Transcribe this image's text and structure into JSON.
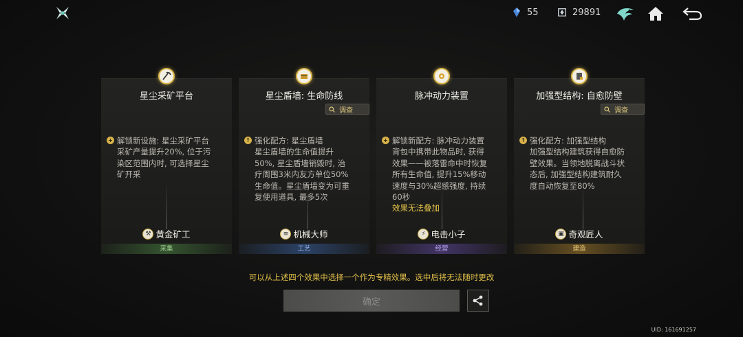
{
  "topbar": {
    "currency_a": "55",
    "currency_b": "29891"
  },
  "cards": [
    {
      "title": "星尘采矿平台",
      "has_investigate": false,
      "desc_lines": [
        "解锁新设施: 星尘采矿平台",
        "采矿产量提升20%, 位于污",
        "染区范围内时, 可选择星尘",
        "矿开采"
      ],
      "extra": "",
      "talent": "黄金矿工",
      "tag": "采集",
      "tag_color": "#9fce8f"
    },
    {
      "title": "星尘盾墙: 生命防线",
      "has_investigate": true,
      "investigate_label": "调查",
      "desc_lines": [
        "强化配方: 星尘盾墙",
        "星尘盾墙的生命值提升",
        "50%, 星尘盾墙销毁时, 治",
        "疗周围3米内友方单位50%",
        "生命值。星尘盾墙变为可重",
        "复使用道具, 最多5次"
      ],
      "extra": "",
      "talent": "机械大师",
      "tag": "工艺",
      "tag_color": "#93b3e4"
    },
    {
      "title": "脉冲动力装置",
      "has_investigate": false,
      "desc_lines": [
        "解锁新配方: 脉冲动力装置",
        "背包中携带此物品时, 获得",
        "效果——被落雷命中时恢复",
        "所有生命值, 提升15%移动",
        "速度与30%超感强度, 持续",
        "60秒"
      ],
      "extra": "效果无法叠加",
      "talent": "电击小子",
      "tag": "经营",
      "tag_color": "#b3a1e4"
    },
    {
      "title": "加强型结构: 自愈防壁",
      "has_investigate": true,
      "investigate_label": "调查",
      "desc_lines": [
        "强化配方: 加强型结构",
        "加强型结构建筑获得自愈防",
        "壁效果。当领地脱离战斗状",
        "态后, 加强型结构建筑耐久",
        "度自动恢复至80%"
      ],
      "extra": "",
      "talent": "奇观匠人",
      "tag": "建造",
      "tag_color": "#e7c577"
    }
  ],
  "hint": "可以从上述四个效果中选择一个作为专精效果。选中后将无法随时更改",
  "confirm_label": "确定",
  "uid": "UID: 161691257"
}
